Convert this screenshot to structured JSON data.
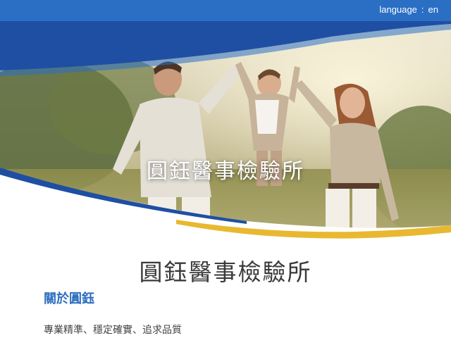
{
  "header": {
    "language_label": "language",
    "language_value": "en"
  },
  "hero": {
    "title": "圓鈺醫事檢驗所"
  },
  "main": {
    "site_title": "圓鈺醫事檢驗所",
    "about_heading": "關於圓鈺",
    "tagline": "專業精準、穩定確實、追求品質"
  },
  "colors": {
    "topbar": "#2a6fc4",
    "hero_wave_blue": "#1f4fa3",
    "accent_gold": "#e8b830",
    "heading_blue": "#2e6fbf"
  },
  "icons": {
    "photo": "family-photo"
  }
}
